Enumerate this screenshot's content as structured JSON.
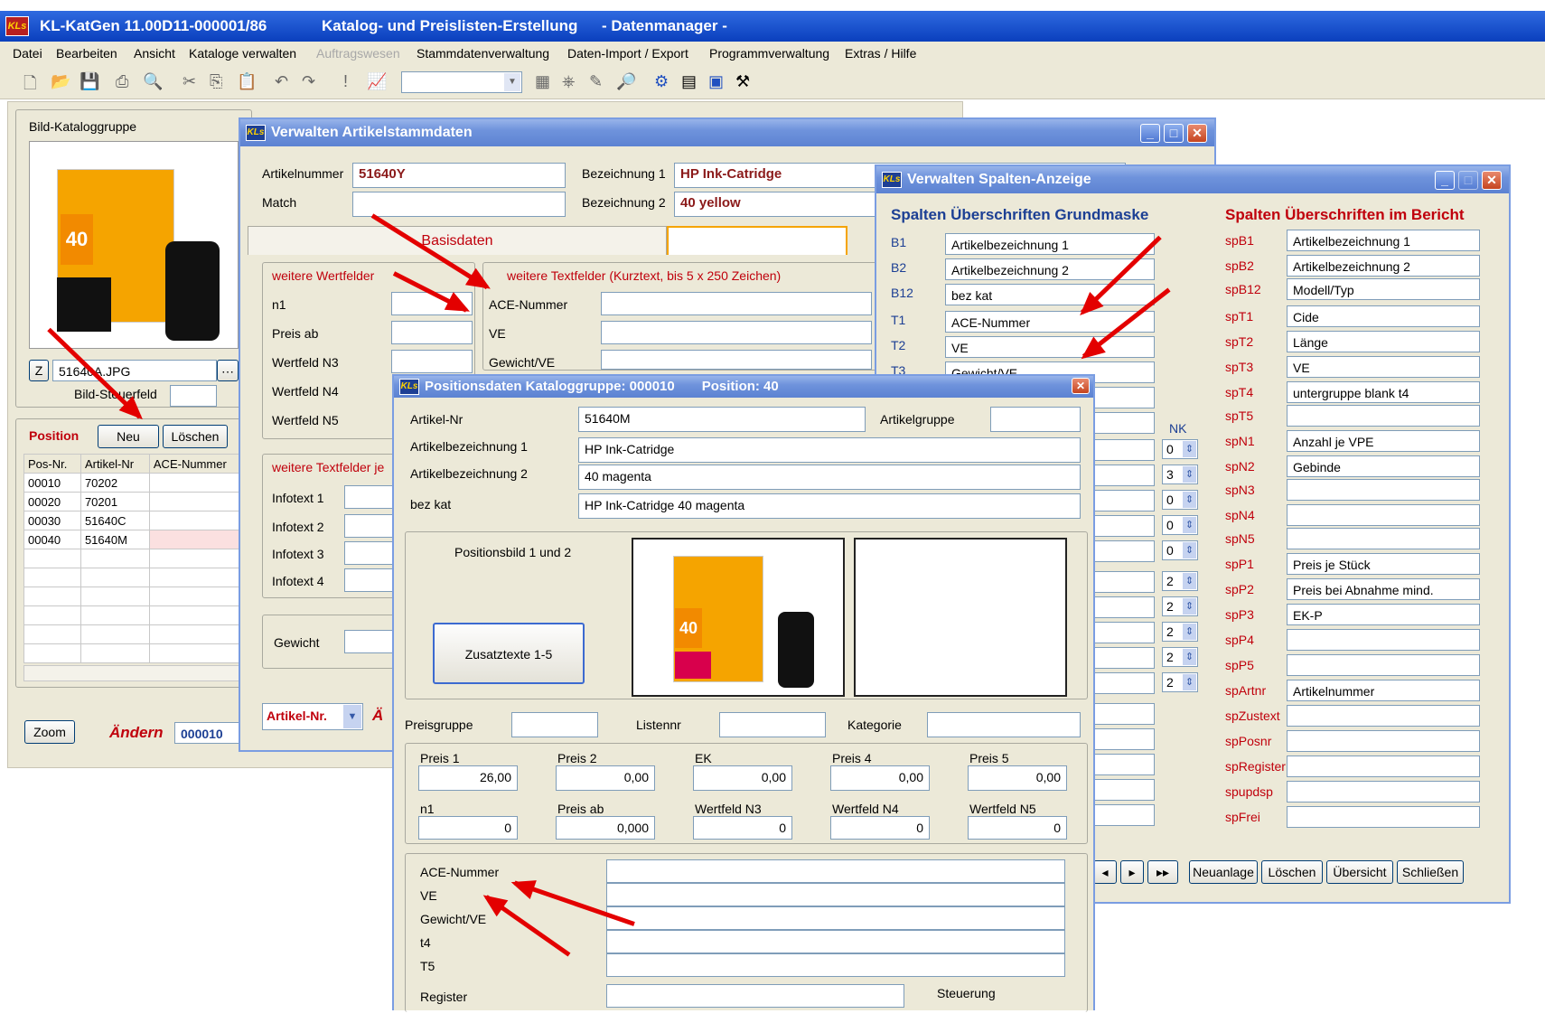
{
  "app": {
    "title": "KL-KatGen 11.00D11-000001/86",
    "subtitle": "Katalog- und Preislisten-Erstellung",
    "mode": "- Datenmanager -"
  },
  "menu": [
    "Datei",
    "Bearbeiten",
    "Ansicht",
    "Kataloge verwalten",
    "Auftragswesen",
    "Stammdatenverwaltung",
    "Daten-Import / Export",
    "Programmverwaltung",
    "Extras / Hilfe"
  ],
  "main": {
    "group_title": "Bild-Kataloggruppe",
    "image_file": "51640A.JPG",
    "z_button": "Z",
    "bild_steuerfeld_label": "Bild-Steuerfeld",
    "position_label": "Position",
    "neu_button": "Neu",
    "loeschen_button": "Löschen",
    "columns": [
      "Pos-Nr.",
      "Artikel-Nr",
      "ACE-Nummer"
    ],
    "rows": [
      [
        "00010",
        "70202",
        ""
      ],
      [
        "00020",
        "70201",
        ""
      ],
      [
        "00030",
        "51640C",
        ""
      ],
      [
        "00040",
        "51640M",
        ""
      ]
    ],
    "zoom_button": "Zoom",
    "aendern_label": "Ändern",
    "aendern_value": "000010"
  },
  "artikel_window": {
    "title": "Verwalten Artikelstammdaten",
    "artikelnummer_label": "Artikelnummer",
    "artikelnummer": "51640Y",
    "match_label": "Match",
    "match": "",
    "bez1_label": "Bezeichnung 1",
    "bez1": "HP Ink-Catridge",
    "bez2_label": "Bezeichnung 2",
    "bez2": "40 yellow",
    "tab_basisdaten": "Basisdaten",
    "wertfelder_title": "weitere Wertfelder",
    "wertfelder": [
      "n1",
      "Preis ab",
      "Wertfeld N3",
      "Wertfeld N4",
      "Wertfeld N5"
    ],
    "textfelder_title": "weitere Textfelder (Kurztext, bis 5 x  250 Zeichen)",
    "textfelder": [
      "ACE-Nummer",
      "VE",
      "Gewicht/VE"
    ],
    "textfelder2_title": "weitere Textfelder je",
    "infotexte": [
      "Infotext 1",
      "Infotext 2",
      "Infotext 3",
      "Infotext 4"
    ],
    "gewicht_label": "Gewicht",
    "sort_select": "Artikel-Nr.",
    "aendern_label": "Ä"
  },
  "spalten_window": {
    "title": "Verwalten Spalten-Anzeige",
    "left_header": "Spalten Überschriften  Grundmaske",
    "right_header": "Spalten Überschriften im Bericht",
    "nk_label": "NK",
    "left_rows": [
      {
        "code": "B1",
        "value": "Artikelbezeichnung 1"
      },
      {
        "code": "B2",
        "value": "Artikelbezeichnung 2"
      },
      {
        "code": "B12",
        "value": "bez kat"
      },
      {
        "code": "T1",
        "value": "ACE-Nummer"
      },
      {
        "code": "T2",
        "value": "VE"
      },
      {
        "code": "T3",
        "value": "Gewicht/VE"
      }
    ],
    "nk_values": [
      "0",
      "3",
      "0",
      "0",
      "0",
      "2",
      "2",
      "2",
      "2",
      "2"
    ],
    "right_rows": [
      {
        "code": "spB1",
        "value": "Artikelbezeichnung 1"
      },
      {
        "code": "spB2",
        "value": "Artikelbezeichnung  2"
      },
      {
        "code": "spB12",
        "value": "Modell/Typ"
      },
      {
        "code": "spT1",
        "value": "Cide"
      },
      {
        "code": "spT2",
        "value": "Länge"
      },
      {
        "code": "spT3",
        "value": "VE"
      },
      {
        "code": "spT4",
        "value": "untergruppe blank          t4"
      },
      {
        "code": "spT5",
        "value": ""
      },
      {
        "code": "spN1",
        "value": "Anzahl je VPE"
      },
      {
        "code": "spN2",
        "value": "Gebinde"
      },
      {
        "code": "spN3",
        "value": ""
      },
      {
        "code": "spN4",
        "value": ""
      },
      {
        "code": "spN5",
        "value": ""
      },
      {
        "code": "spP1",
        "value": "Preis je Stück"
      },
      {
        "code": "spP2",
        "value": "Preis bei Abnahme mind."
      },
      {
        "code": "spP3",
        "value": "EK-P"
      },
      {
        "code": "spP4",
        "value": ""
      },
      {
        "code": "spP5",
        "value": ""
      },
      {
        "code": "spArtnr",
        "value": "Artikelnummer"
      },
      {
        "code": "spZustext",
        "value": ""
      },
      {
        "code": "spPosnr",
        "value": ""
      },
      {
        "code": "spRegister",
        "value": ""
      },
      {
        "code": "spupdsp",
        "value": ""
      },
      {
        "code": "spFrei",
        "value": ""
      }
    ],
    "buttons": [
      "Neuanlage",
      "Löschen",
      "Übersicht",
      "Schließen"
    ]
  },
  "position_window": {
    "title": "Positionsdaten  Kataloggruppe: 000010",
    "position": "Position: 40",
    "artikel_nr_label": "Artikel-Nr",
    "artikel_nr": "51640M",
    "artikelgruppe_label": "Artikelgruppe",
    "artikelgruppe": "",
    "bez1_label": "Artikelbezeichnung 1",
    "bez1": "HP Ink-Catridge",
    "bez2_label": "Artikelbezeichnung 2",
    "bez2": "40 magenta",
    "bezkat_label": "bez kat",
    "bezkat": "HP Ink-Catridge 40 magenta",
    "bild_label": "Positionsbild 1 und 2",
    "zusatz_button": "Zusatztexte 1-5",
    "preisgruppe_label": "Preisgruppe",
    "listennr_label": "Listennr",
    "kategorie_label": "Kategorie",
    "prices": [
      {
        "label": "Preis 1",
        "value": "26,00"
      },
      {
        "label": "Preis 2",
        "value": "0,00"
      },
      {
        "label": "EK",
        "value": "0,00"
      },
      {
        "label": "Preis 4",
        "value": "0,00"
      },
      {
        "label": "Preis 5",
        "value": "0,00"
      }
    ],
    "values": [
      {
        "label": "n1",
        "value": "0"
      },
      {
        "label": "Preis ab",
        "value": "0,000"
      },
      {
        "label": "Wertfeld N3",
        "value": "0"
      },
      {
        "label": "Wertfeld N4",
        "value": "0"
      },
      {
        "label": "Wertfeld N5",
        "value": "0"
      }
    ],
    "texts": [
      "ACE-Nummer",
      "VE",
      "Gewicht/VE",
      "t4",
      "T5"
    ],
    "register_label": "Register",
    "steuerung_label": "Steuerung"
  },
  "colors": {
    "title_blue": "#5c82d2",
    "arrow_red": "#e30000",
    "label_red": "#c0000c",
    "header_blue": "#1c3f94"
  }
}
